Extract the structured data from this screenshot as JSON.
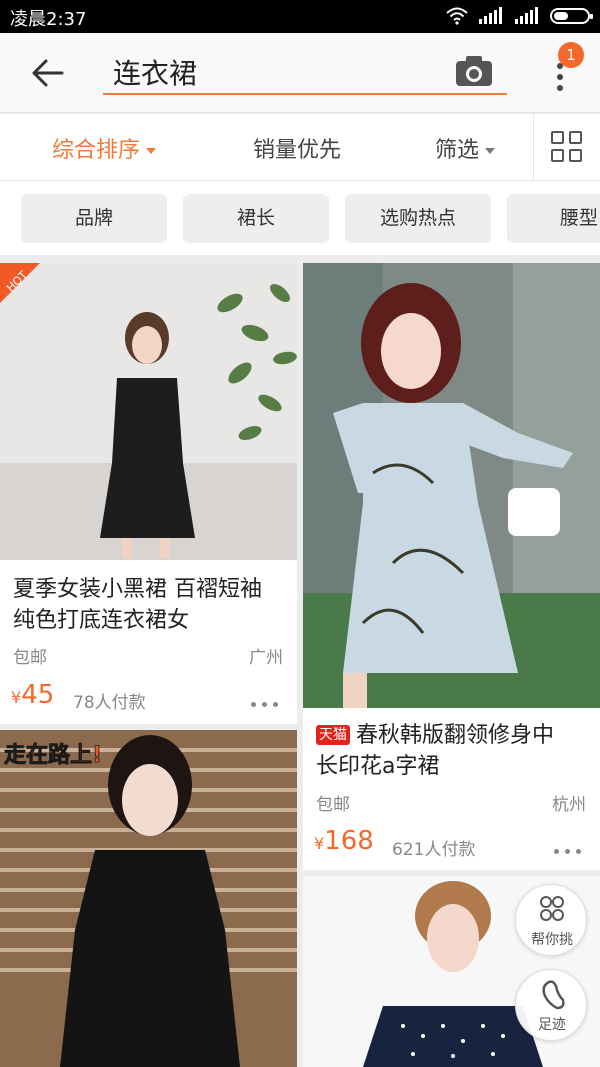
{
  "status_bar": {
    "time": "凌晨2:37"
  },
  "search": {
    "query": "连衣裙",
    "notification_count": "1"
  },
  "sort_bar": {
    "items": [
      {
        "label": "综合排序",
        "active": true
      },
      {
        "label": "销量优先",
        "active": false
      },
      {
        "label": "筛选",
        "active": false
      }
    ]
  },
  "filters": [
    "品牌",
    "裙长",
    "选购热点",
    "腰型"
  ],
  "products": [
    {
      "title_line1": "夏季女装小黑裙 百褶短袖",
      "title_line2": "纯色打底连衣裙女",
      "badge": "HOT",
      "shipping": "包邮",
      "location": "广州",
      "currency": "¥",
      "price": "45",
      "sold": "78人付款"
    },
    {
      "title_line1": "春秋韩版翻领修身中",
      "title_line2": "长印花a字裙",
      "tmall_tag": "天猫",
      "shipping": "包邮",
      "location": "杭州",
      "currency": "¥",
      "price": "168",
      "sold": "621人付款"
    },
    {
      "image_caption": "走在路上!"
    },
    {}
  ],
  "floating": {
    "help_label": "帮你挑",
    "footprint_label": "足迹"
  },
  "colors": {
    "accent": "#f07a3a",
    "price": "#f5682b",
    "badge": "#f5682b",
    "tmall": "#e2231a"
  }
}
